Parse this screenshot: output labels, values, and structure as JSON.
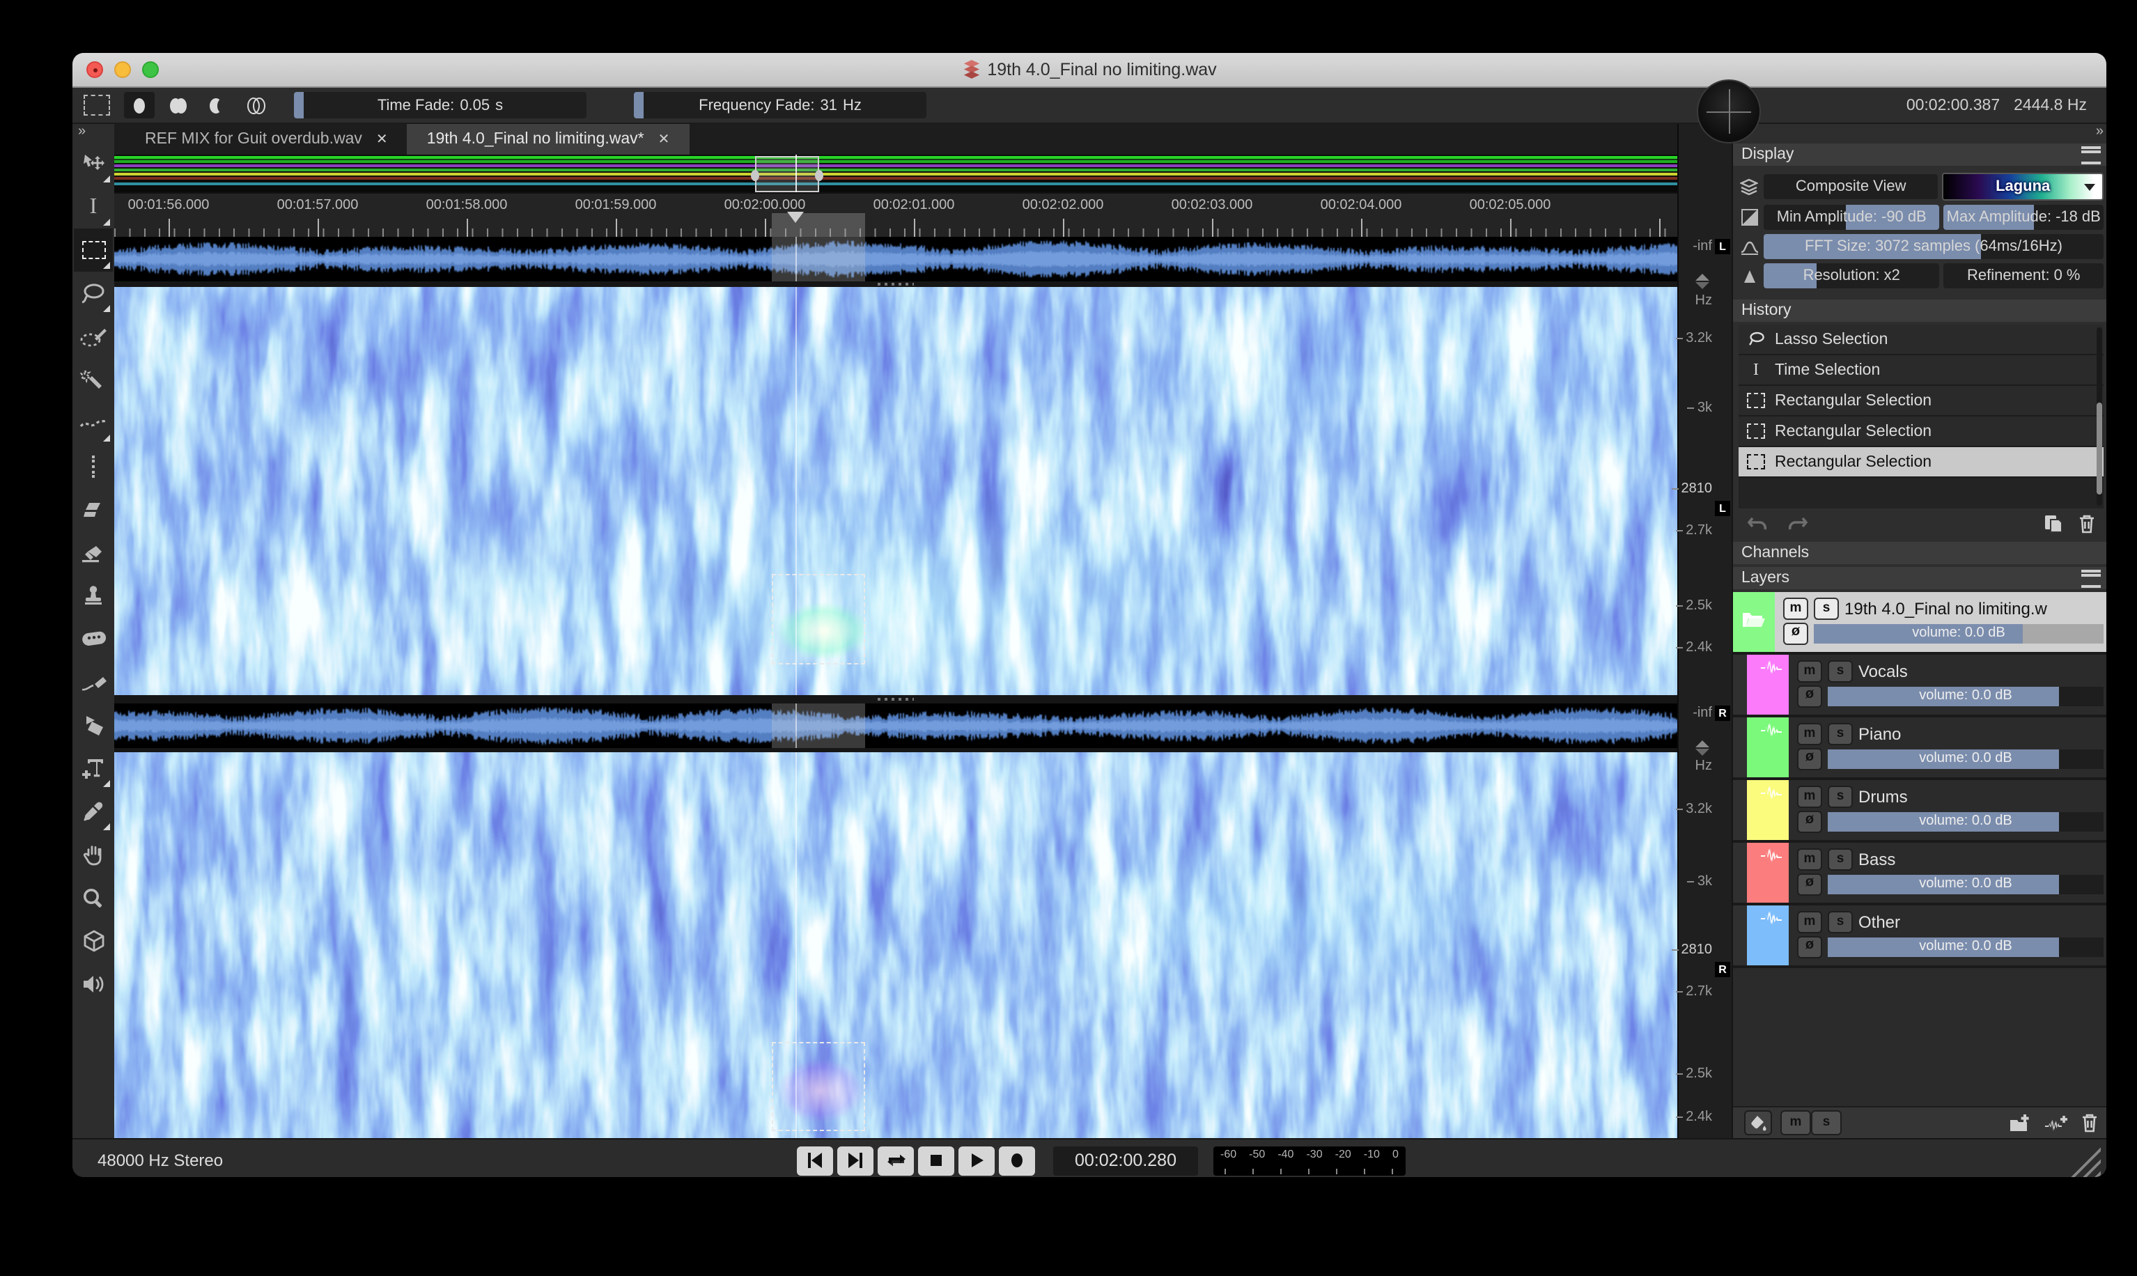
{
  "window": {
    "title": "19th 4.0_Final no limiting.wav"
  },
  "ui": {
    "overflow_glyph": "»"
  },
  "toolbar": {
    "time_fade": {
      "label": "Time Fade:",
      "value": "0.05",
      "unit": "s"
    },
    "frequency_fade": {
      "label": "Frequency Fade:",
      "value": "31",
      "unit": "Hz"
    },
    "cursor_readout": {
      "time": "00:02:00.387",
      "frequency": "2444.8 Hz"
    }
  },
  "tabs": [
    {
      "label": "REF MIX for Guit overdub.wav",
      "close": "✕"
    },
    {
      "label": "19th 4.0_Final no limiting.wav*",
      "close": "✕"
    }
  ],
  "timeline": {
    "labels": [
      "00:01:56.000",
      "00:01:57.000",
      "00:01:58.000",
      "00:01:59.000",
      "00:02:00.000",
      "00:02:01.000",
      "00:02:02.000",
      "00:02:03.000",
      "00:02:04.000",
      "00:02:05.000"
    ]
  },
  "channels": {
    "left": {
      "badge": "L",
      "neg_inf": "-inf",
      "axis_unit": "Hz",
      "freq_ticks": [
        "3.2k",
        "3k",
        "2810",
        "2.7k",
        "2.5k",
        "2.4k"
      ]
    },
    "right": {
      "badge": "R",
      "neg_inf": "-inf",
      "axis_unit": "Hz",
      "freq_ticks": [
        "3.2k",
        "3k",
        "2810",
        "2.7k",
        "2.5k",
        "2.4k"
      ]
    }
  },
  "display_panel": {
    "title": "Display",
    "composite_view_label": "Composite View",
    "colormap_name": "Laguna",
    "min_amplitude": {
      "label": "Min Amplitude:",
      "value": "-90",
      "unit": "dB"
    },
    "max_amplitude": {
      "label": "Max Amplitude:",
      "value": "-18",
      "unit": "dB"
    },
    "fft_size": {
      "label": "FFT Size:",
      "value": "3072 samples (64ms/16Hz)"
    },
    "resolution": {
      "label": "Resolution:",
      "value": "x2"
    },
    "refinement": {
      "label": "Refinement:",
      "value": "0",
      "unit": "%"
    }
  },
  "history_panel": {
    "title": "History",
    "items": [
      {
        "label": "Lasso Selection",
        "icon": "lasso"
      },
      {
        "label": "Time Selection",
        "icon": "ibeam"
      },
      {
        "label": "Rectangular Selection",
        "icon": "rect"
      },
      {
        "label": "Rectangular Selection",
        "icon": "rect"
      },
      {
        "label": "Rectangular Selection",
        "icon": "rect",
        "selected": true
      }
    ]
  },
  "channels_panel": {
    "title": "Channels"
  },
  "layers_panel": {
    "title": "Layers",
    "mute_label": "m",
    "solo_label": "s",
    "phase_label": "ø",
    "layers": [
      {
        "name": "19th 4.0_Final no limiting.w",
        "color": "#86f986",
        "volume_label": "volume: 0.0 dB",
        "type": "group",
        "selected": true
      },
      {
        "name": "Vocals",
        "color": "#fb7bfb",
        "volume_label": "volume: 0.0 dB"
      },
      {
        "name": "Piano",
        "color": "#7bf97b",
        "volume_label": "volume: 0.0 dB"
      },
      {
        "name": "Drums",
        "color": "#fbfb7d",
        "volume_label": "volume: 0.0 dB"
      },
      {
        "name": "Bass",
        "color": "#fb7d7d",
        "volume_label": "volume: 0.0 dB"
      },
      {
        "name": "Other",
        "color": "#7dbdfb",
        "volume_label": "volume: 0.0 dB"
      }
    ]
  },
  "status_bar": {
    "sample_rate": "48000 Hz Stereo",
    "playhead_time": "00:02:00.280",
    "meter_labels": [
      "-60",
      "-50",
      "-40",
      "-30",
      "-20",
      "-10",
      "0"
    ]
  },
  "colors": {
    "slider_fill": "#7b8dad",
    "selection_row": "#c9c9c9",
    "spectrogram_colormap": "Laguna"
  }
}
